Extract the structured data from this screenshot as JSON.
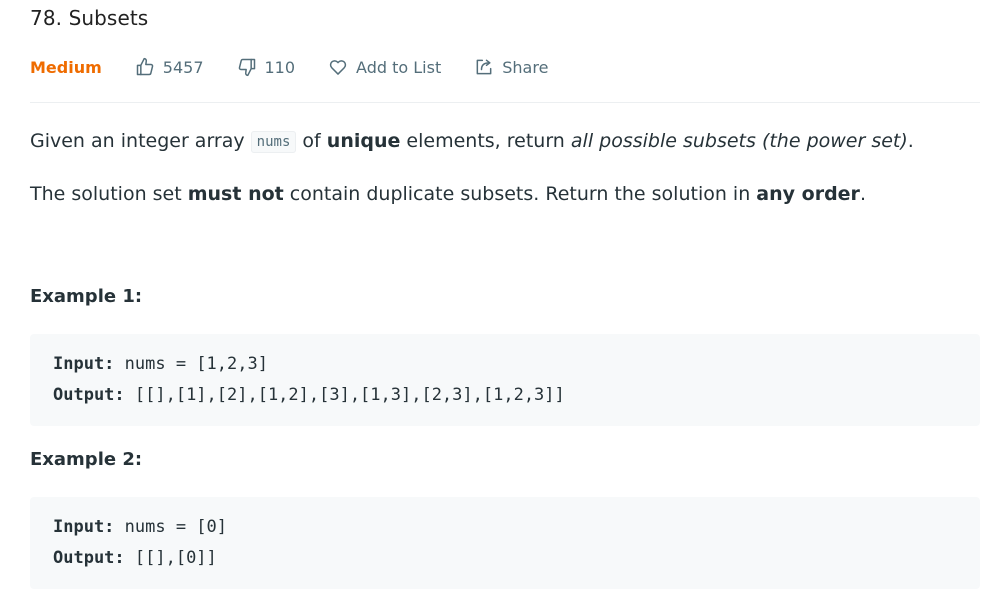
{
  "problem": {
    "title": "78. Subsets",
    "difficulty": "Medium",
    "likes": "5457",
    "dislikes": "110",
    "add_to_list": "Add to List",
    "share": "Share"
  },
  "description": {
    "p1_a": "Given an integer array ",
    "p1_code": "nums",
    "p1_b": " of ",
    "p1_bold": "unique",
    "p1_c": " elements, return ",
    "p1_italic": "all possible subsets (the power set)",
    "p1_d": ".",
    "p2_a": "The solution set ",
    "p2_bold1": "must not",
    "p2_b": " contain duplicate subsets. Return the solution in ",
    "p2_bold2": "any order",
    "p2_c": "."
  },
  "examples": [
    {
      "title": "Example 1:",
      "input_label": "Input:",
      "input_value": " nums = [1,2,3]",
      "output_label": "Output:",
      "output_value": " [[],[1],[2],[1,2],[3],[1,3],[2,3],[1,2,3]]"
    },
    {
      "title": "Example 2:",
      "input_label": "Input:",
      "input_value": " nums = [0]",
      "output_label": "Output:",
      "output_value": " [[],[0]]"
    }
  ],
  "icons": {
    "like": "thumbs-up-icon",
    "dislike": "thumbs-down-icon",
    "add": "heart-icon",
    "share": "share-icon"
  },
  "colors": {
    "difficulty": "#ef6c00",
    "meta": "#546e7a",
    "code_bg": "#f7f9fa"
  }
}
